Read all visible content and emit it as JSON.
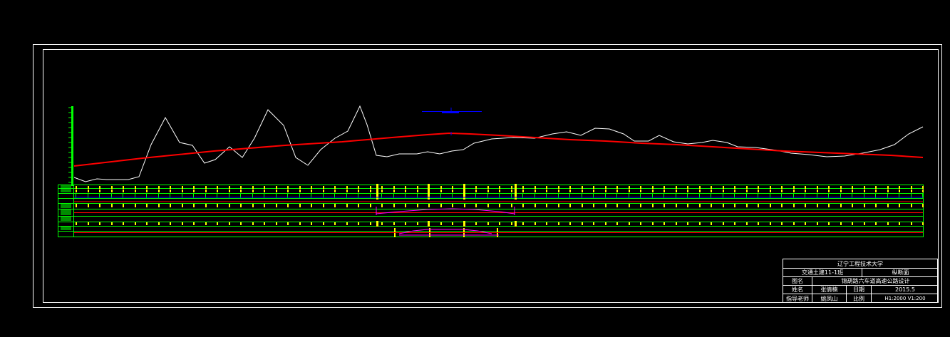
{
  "drawing": {
    "colors": {
      "background": "#000000",
      "frame": "#ffffff",
      "ground_line": "#ffffff",
      "design_line": "#ff0000",
      "table_grid": "#00ff00",
      "table_marks": "#ffff00",
      "vertical_curve": "#0000ff",
      "grade_change": "#ff00ff"
    }
  },
  "title_block": {
    "school": "辽宁工程技术大学",
    "class_name": "交通土建11-1班",
    "sheet_title": "纵断面",
    "drawing_name_label": "图名",
    "drawing_name": "锦葫路六车道高速公路设计",
    "author_label": "姓名",
    "author": "张倩楠",
    "date_label": "日期",
    "date": "2015.5",
    "advisor_label": "指导老师",
    "advisor": "姚凤山",
    "scale_label": "比例",
    "scale": "H1:2000    V1:200"
  }
}
